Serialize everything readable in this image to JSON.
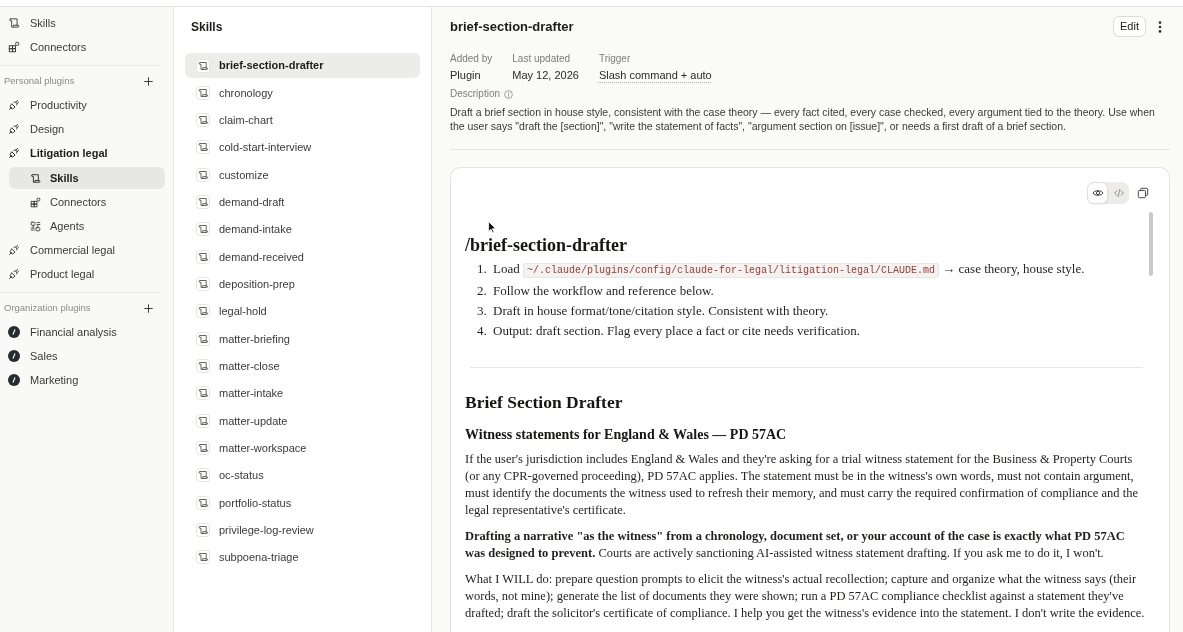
{
  "sidebar": {
    "nav": [
      {
        "kind": "skills",
        "label": "Skills"
      },
      {
        "kind": "connectors",
        "label": "Connectors"
      }
    ],
    "sections": [
      {
        "kind": "personal",
        "title": "Personal plugins",
        "plugins": [
          {
            "label": "Productivity",
            "expanded": false
          },
          {
            "label": "Design",
            "expanded": false
          },
          {
            "label": "Litigation legal",
            "expanded": true,
            "children": [
              {
                "kind": "skills",
                "label": "Skills",
                "selected": true
              },
              {
                "kind": "connectors",
                "label": "Connectors",
                "selected": false
              },
              {
                "kind": "agents",
                "label": "Agents",
                "selected": false
              }
            ]
          },
          {
            "label": "Commercial legal",
            "expanded": false
          },
          {
            "label": "Product legal",
            "expanded": false
          }
        ]
      },
      {
        "kind": "organization",
        "title": "Organization plugins",
        "plugins": [
          {
            "label": "Financial analysis",
            "expanded": false
          },
          {
            "label": "Sales",
            "expanded": false
          },
          {
            "label": "Marketing",
            "expanded": false
          }
        ]
      }
    ]
  },
  "skills_panel": {
    "title": "Skills",
    "items": [
      {
        "label": "brief-section-drafter",
        "selected": true
      },
      {
        "label": "chronology",
        "selected": false
      },
      {
        "label": "claim-chart",
        "selected": false
      },
      {
        "label": "cold-start-interview",
        "selected": false
      },
      {
        "label": "customize",
        "selected": false
      },
      {
        "label": "demand-draft",
        "selected": false
      },
      {
        "label": "demand-intake",
        "selected": false
      },
      {
        "label": "demand-received",
        "selected": false
      },
      {
        "label": "deposition-prep",
        "selected": false
      },
      {
        "label": "legal-hold",
        "selected": false
      },
      {
        "label": "matter-briefing",
        "selected": false
      },
      {
        "label": "matter-close",
        "selected": false
      },
      {
        "label": "matter-intake",
        "selected": false
      },
      {
        "label": "matter-update",
        "selected": false
      },
      {
        "label": "matter-workspace",
        "selected": false
      },
      {
        "label": "oc-status",
        "selected": false
      },
      {
        "label": "portfolio-status",
        "selected": false
      },
      {
        "label": "privilege-log-review",
        "selected": false
      },
      {
        "label": "subpoena-triage",
        "selected": false
      }
    ]
  },
  "detail": {
    "title": "brief-section-drafter",
    "edit_button": "Edit",
    "meta": [
      {
        "kind": "plain",
        "label": "Added by",
        "value": "Plugin"
      },
      {
        "kind": "plain",
        "label": "Last updated",
        "value": "May 12, 2026"
      },
      {
        "kind": "hint",
        "label": "Trigger",
        "value": "Slash command + auto"
      }
    ],
    "description_label": "Description",
    "description": "Draft a brief section in house style, consistent with the case theory — every fact cited, every case checked, every argument tied to the theory. Use when the user says \"draft the [section]\", \"write the statement of facts\", \"argument section on [issue]\", or needs a first draft of a brief section.",
    "viewer": {
      "view_modes": [
        {
          "kind": "preview",
          "selected": true
        },
        {
          "kind": "source",
          "selected": false
        }
      ],
      "blocks": [
        {
          "kind": "h1",
          "text": "/brief-section-drafter"
        },
        {
          "kind": "ol",
          "items": [
            {
              "number": "1.",
              "parts": [
                {
                  "kind": "text",
                  "text": "Load "
                },
                {
                  "kind": "code",
                  "text": "~/.claude/plugins/config/claude-for-legal/litigation-legal/CLAUDE.md"
                },
                {
                  "kind": "text",
                  "text": " → case theory, house style."
                }
              ]
            },
            {
              "number": "2.",
              "parts": [
                {
                  "kind": "text",
                  "text": "Follow the workflow and reference below."
                }
              ]
            },
            {
              "number": "3.",
              "parts": [
                {
                  "kind": "text",
                  "text": "Draft in house format/tone/citation style. Consistent with theory."
                }
              ]
            },
            {
              "number": "4.",
              "parts": [
                {
                  "kind": "text",
                  "text": "Output: draft section. Flag every place a fact or cite needs verification."
                }
              ]
            }
          ]
        },
        {
          "kind": "hr"
        },
        {
          "kind": "h2",
          "text": "Brief Section Drafter"
        },
        {
          "kind": "h3",
          "text": "Witness statements for England & Wales — PD 57AC"
        },
        {
          "kind": "p",
          "text": "If the user's jurisdiction includes England & Wales and they're asking for a trial witness statement for the Business & Property Courts (or any CPR-governed proceeding), PD 57AC applies. The statement must be in the witness's own words, must not contain argument, must identify the documents the witness used to refresh their memory, and must carry the required confirmation of compliance and the legal representative's certificate."
        },
        {
          "kind": "p",
          "text": "**Drafting a narrative \"as the witness\" from a chronology, document set, or your account of the case is exactly what PD 57AC was designed to prevent.** Courts are actively sanctioning AI-assisted witness statement drafting. If you ask me to do it, I won't."
        },
        {
          "kind": "p",
          "text": "What I WILL do: prepare question prompts to elicit the witness's actual recollection; capture and organize what the witness says (their words, not mine); generate the list of documents they were shown; run a PD 57AC compliance checklist against a statement they've drafted; draft the solicitor's certificate of compliance. I help you get the witness's evidence into the statement. I don't write the evidence."
        }
      ]
    }
  }
}
